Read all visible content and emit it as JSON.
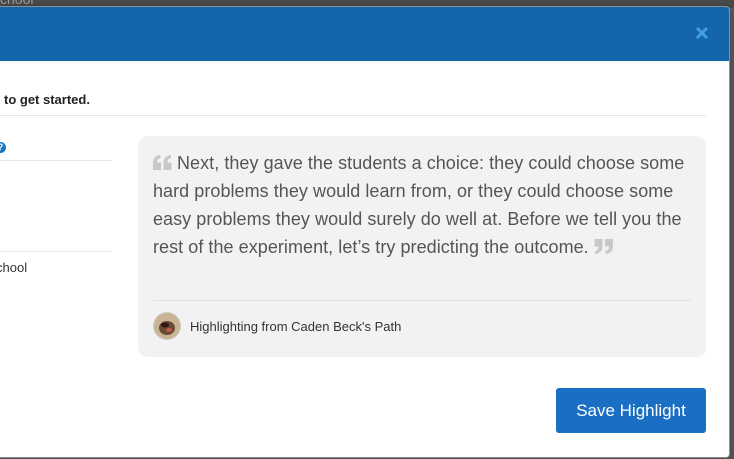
{
  "background": {
    "partial_text": "chool"
  },
  "modal": {
    "header_color": "#1565ab",
    "close_icon": "close-icon",
    "instruction": "to get started.",
    "help_icon": "help-icon",
    "sidebar": {
      "partial_text": "chool"
    },
    "quote": {
      "text": "Next, they gave the students a choice: they could choose some hard problems they would learn from, or they could choose some easy problems they would surely do well at. Before we tell you the rest of the experiment, let’s try predicting the outcome.",
      "open_icon": "open-quote-icon",
      "close_icon": "close-quote-icon"
    },
    "attribution": {
      "avatar": "avatar",
      "text": "Highlighting from Caden Beck's Path"
    },
    "save_button": "Save Highlight",
    "accent_color": "#1a6fc4"
  }
}
